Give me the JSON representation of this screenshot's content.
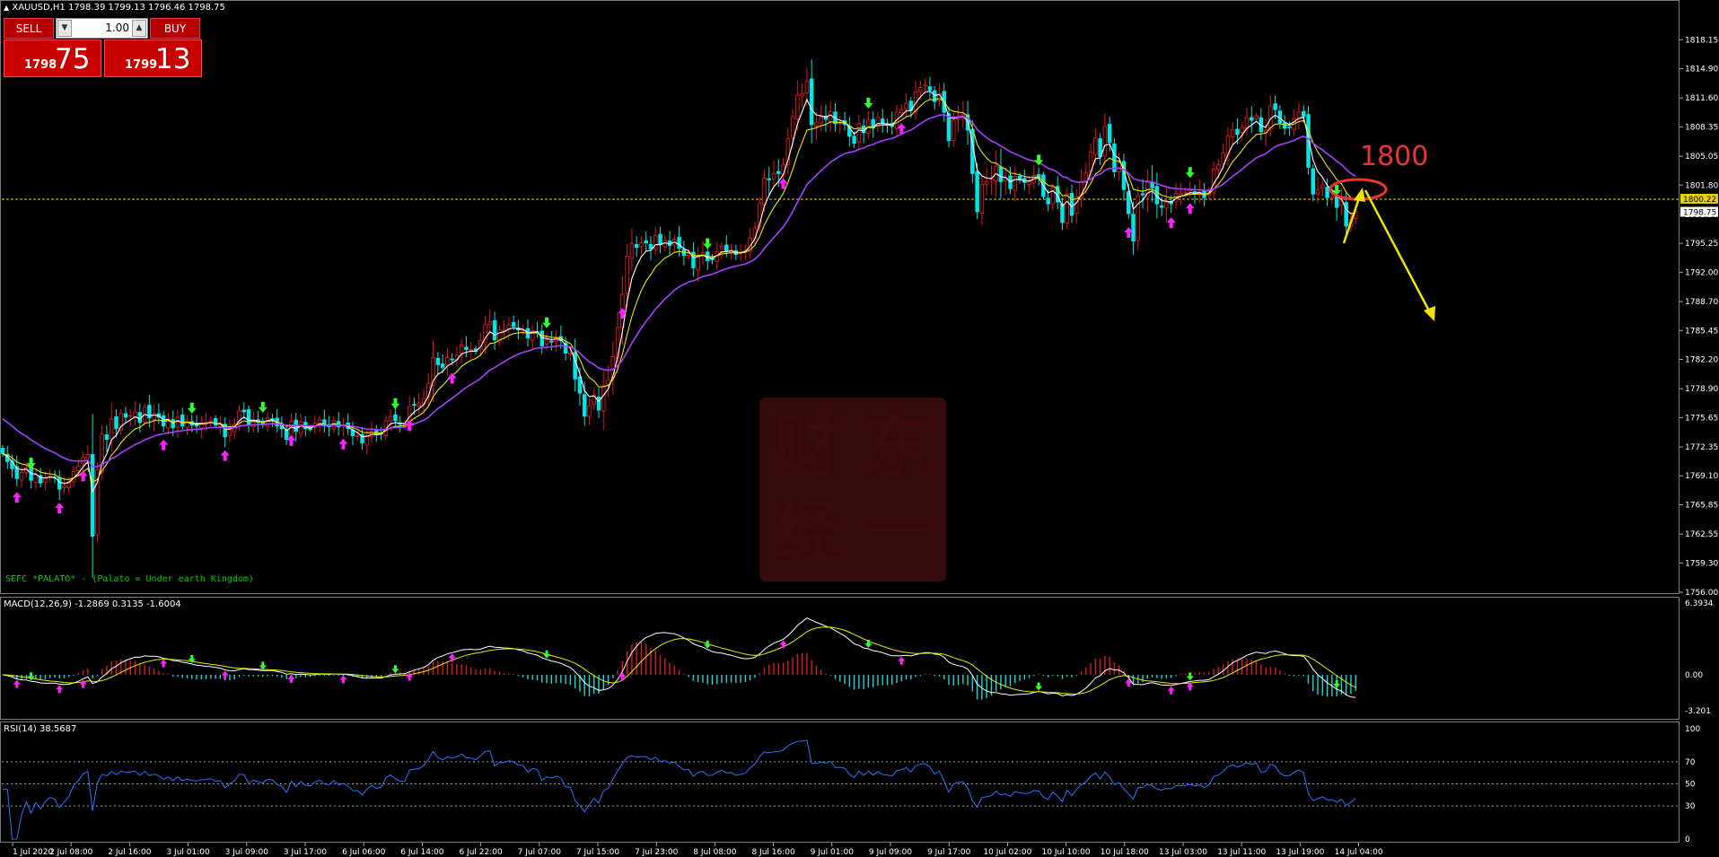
{
  "window": {
    "title": "XAUUSD,H1  1798.39 1799.13 1796.46 1798.75"
  },
  "trade_panel": {
    "sell_label": "SELL",
    "buy_label": "BUY",
    "lot_value": "1.00",
    "bid_small": "1798",
    "bid_big": "75",
    "ask_small": "1799",
    "ask_big": "13"
  },
  "colors": {
    "bull_candle": "#e01818",
    "bear_candle": "#00e6e6",
    "ma_fast": "#ffffff",
    "ma_mid": "#e8e800",
    "ma_slow": "#a640ff",
    "buy_arrow": "#ff20ff",
    "sell_arrow": "#30ff30",
    "rsi_line": "#2a73ff",
    "grid_dots": "#9a9a9a",
    "annotation": "#ee3333",
    "level_line": "#e6d200"
  },
  "indicator_caption": "SEFC *PALATO* - (Palato = Under earth Kingdom)",
  "macd_caption": "MACD(12,26,9) -1.2869 0.3135 -1.6004",
  "rsi_caption": "RSI(14) 38.5687",
  "watermark_chars": [
    "财",
    "东",
    "经",
    "一"
  ],
  "annotation_text": "1800",
  "chart_data": [
    {
      "type": "candlestick",
      "symbol": "XAUUSD",
      "timeframe": "H1",
      "ylim": [
        1756.0,
        1820.0
      ],
      "y_ticks": [
        "1818.15",
        "1814.90",
        "1811.60",
        "1808.35",
        "1805.05",
        "1801.80",
        "1798.50",
        "1795.25",
        "1792.00",
        "1788.70",
        "1785.45",
        "1782.20",
        "1778.90",
        "1775.65",
        "1772.35",
        "1769.10",
        "1765.85",
        "1762.55",
        "1759.30",
        "1756.00"
      ],
      "x_ticks": [
        "1 Jul 2020",
        "2 Jul 08:00",
        "2 Jul 16:00",
        "3 Jul 01:00",
        "3 Jul 09:00",
        "3 Jul 17:00",
        "6 Jul 06:00",
        "6 Jul 14:00",
        "6 Jul 22:00",
        "7 Jul 07:00",
        "7 Jul 15:00",
        "7 Jul 23:00",
        "8 Jul 08:00",
        "8 Jul 16:00",
        "9 Jul 01:00",
        "9 Jul 09:00",
        "9 Jul 17:00",
        "10 Jul 02:00",
        "10 Jul 10:00",
        "10 Jul 18:00",
        "13 Jul 03:00",
        "13 Jul 11:00",
        "13 Jul 19:00",
        "14 Jul 04:00"
      ],
      "price_labels": {
        "level": "1800.22",
        "bid": "1798.75"
      },
      "level_value": 1800.22,
      "bid_value": 1798.75,
      "closes": [
        1771.6,
        1770.7,
        1769.9,
        1768.8,
        1769.5,
        1770.0,
        1768.6,
        1769.2,
        1768.3,
        1768.8,
        1769.1,
        1768.9,
        1767.6,
        1768.0,
        1768.5,
        1769.6,
        1770.2,
        1771.2,
        1771.5,
        1762.3,
        1769.8,
        1773.8,
        1773.2,
        1775.5,
        1774.4,
        1776.1,
        1775.7,
        1775.9,
        1776.3,
        1775.1,
        1776.8,
        1775.6,
        1776.1,
        1775.7,
        1774.7,
        1775.5,
        1774.5,
        1775.7,
        1774.7,
        1775.2,
        1774.8,
        1774.7,
        1775.0,
        1775.1,
        1775.3,
        1774.8,
        1774.9,
        1773.5,
        1774.3,
        1774.9,
        1776.4,
        1776.3,
        1774.8,
        1775.4,
        1775.1,
        1774.9,
        1775.6,
        1775.5,
        1774.7,
        1774.4,
        1773.2,
        1775.2,
        1774.1,
        1775.2,
        1774.4,
        1774.3,
        1775.0,
        1775.4,
        1774.7,
        1774.6,
        1775.3,
        1774.6,
        1774.8,
        1774.4,
        1773.6,
        1773.6,
        1772.8,
        1773.6,
        1774.1,
        1773.7,
        1773.8,
        1775.3,
        1775.8,
        1775.3,
        1774.9,
        1774.9,
        1776.9,
        1777.1,
        1777.2,
        1777.8,
        1779.5,
        1782.4,
        1781.6,
        1781.3,
        1782.4,
        1782.2,
        1782.7,
        1783.8,
        1783.3,
        1783.3,
        1783.1,
        1784.3,
        1786.1,
        1786.4,
        1784.4,
        1785.5,
        1785.5,
        1786.1,
        1785.9,
        1785.5,
        1785.5,
        1784.6,
        1785.4,
        1785.3,
        1783.7,
        1784.4,
        1784.2,
        1784.6,
        1784.3,
        1782.9,
        1782.9,
        1780.0,
        1778.4,
        1775.8,
        1777.0,
        1778.2,
        1776.5,
        1779.2,
        1779.9,
        1782.5,
        1785.8,
        1789.5,
        1793.8,
        1795.2,
        1794.8,
        1795.3,
        1795.3,
        1794.6,
        1796.1,
        1795.1,
        1795.6,
        1795.0,
        1795.7,
        1794.7,
        1793.9,
        1794.1,
        1792.5,
        1793.9,
        1794.2,
        1793.3,
        1793.4,
        1794.3,
        1794.9,
        1794.4,
        1794.5,
        1794.0,
        1794.2,
        1794.5,
        1795.8,
        1797.0,
        1799.8,
        1802.6,
        1802.4,
        1803.1,
        1803.1,
        1804.1,
        1807.0,
        1809.5,
        1811.9,
        1812.1,
        1813.5,
        1808.6,
        1808.8,
        1809.4,
        1809.2,
        1810.1,
        1808.7,
        1808.8,
        1808.6,
        1807.3,
        1806.5,
        1808.7,
        1807.7,
        1809.1,
        1808.2,
        1809.4,
        1808.7,
        1808.6,
        1808.4,
        1810.0,
        1810.3,
        1811.0,
        1810.2,
        1812.3,
        1812.8,
        1813.1,
        1812.5,
        1811.2,
        1812.1,
        1810.0,
        1806.8,
        1809.1,
        1809.6,
        1809.8,
        1808.0,
        1803.1,
        1798.8,
        1801.9,
        1802.2,
        1802.5,
        1803.9,
        1802.2,
        1802.6,
        1801.4,
        1802.8,
        1802.4,
        1802.1,
        1802.2,
        1802.9,
        1802.7,
        1800.5,
        1799.7,
        1801.5,
        1799.9,
        1797.6,
        1800.8,
        1798.4,
        1800.5,
        1802.1,
        1803.2,
        1805.5,
        1807.1,
        1805.0,
        1808.4,
        1806.6,
        1803.3,
        1804.3,
        1801.3,
        1798.6,
        1795.5,
        1800.6,
        1800.7,
        1802.1,
        1801.5,
        1799.7,
        1799.3,
        1799.9,
        1799.7,
        1800.9,
        1800.9,
        1801.0,
        1801.3,
        1800.8,
        1801.1,
        1800.4,
        1801.1,
        1803.6,
        1804.1,
        1805.4,
        1807.3,
        1808.0,
        1807.5,
        1808.3,
        1809.4,
        1809.1,
        1809.6,
        1807.8,
        1808.0,
        1810.7,
        1810.3,
        1808.8,
        1808.2,
        1808.3,
        1809.3,
        1810.0,
        1809.5,
        1803.8,
        1800.8,
        1801.3,
        1801.8,
        1800.4,
        1800.5,
        1799.3,
        1800.0,
        1797.2,
        1797.9,
        1798.8
      ],
      "volatility": [
        0.8,
        1.3,
        1.3,
        1.7,
        1.1,
        1.3,
        1.5,
        0.8,
        0.8,
        1.2,
        1.6,
        0.9,
        1.7,
        1.1,
        0.6,
        1.4,
        1.0,
        1.1,
        1.3,
        9.6,
        1.8,
        1.5,
        2.1,
        2.9,
        1.4,
        1.1,
        0.9,
        1.4,
        1.6,
        1.7,
        1.0,
        1.8,
        1.9,
        1.4,
        0.7,
        1.5,
        1.5,
        1.6,
        0.7,
        1.1,
        1.8,
        1.3,
        1.5,
        1.6,
        0.6,
        0.8,
        1.3,
        1.5,
        1.5,
        1.0,
        1.4,
        1.2,
        0.8,
        1.2,
        1.7,
        0.9,
        0.8,
        1.0,
        1.3,
        1.4,
        1.4,
        1.2,
        1.6,
        0.9,
        1.0,
        0.6,
        1.1,
        0.8,
        1.4,
        1.6,
        1.1,
        1.6,
        1.6,
        1.3,
        1.6,
        1.3,
        1.1,
        1.4,
        1.4,
        0.9,
        1.5,
        0.6,
        1.4,
        1.2,
        1.2,
        1.0,
        1.8,
        1.4,
        1.6,
        1.8,
        2.5,
        3.6,
        1.3,
        1.3,
        1.8,
        1.4,
        1.4,
        1.3,
        1.7,
        1.4,
        0.8,
        1.3,
        1.9,
        2.1,
        1.7,
        1.0,
        1.7,
        1.6,
        0.7,
        1.5,
        1.2,
        1.6,
        1.2,
        1.3,
        1.2,
        1.7,
        1.7,
        1.6,
        1.7,
        1.0,
        1.8,
        2.6,
        2.1,
        2.1,
        1.3,
        1.5,
        1.5,
        3.6,
        2.6,
        3.4,
        3.8,
        3.8,
        2.7,
        2.7,
        1.6,
        1.8,
        1.5,
        1.8,
        1.1,
        1.3,
        1.0,
        1.7,
        1.0,
        1.8,
        1.7,
        1.1,
        1.7,
        1.9,
        2.0,
        1.5,
        1.1,
        1.7,
        0.8,
        1.3,
        0.9,
        1.4,
        1.3,
        1.3,
        1.6,
        1.0,
        1.4,
        1.2,
        2.7,
        2.2,
        2.5,
        1.7,
        1.9,
        1.7,
        2.7,
        2.0,
        3.3,
        4.1,
        2.5,
        2.0,
        2.3,
        2.5,
        1.4,
        1.6,
        1.2,
        1.8,
        1.2,
        1.4,
        1.6,
        1.1,
        1.5,
        1.5,
        1.7,
        1.0,
        1.8,
        1.3,
        1.3,
        1.7,
        0.8,
        1.7,
        1.1,
        1.6,
        1.7,
        0.9,
        1.2,
        1.6,
        1.7,
        1.0,
        2.2,
        2.1,
        2.9,
        2.3,
        1.3,
        1.9,
        2.5,
        2.9,
        4.0,
        3.8,
        2.4,
        1.1,
        1.9,
        0.9,
        1.4,
        1.2,
        1.5,
        1.3,
        0.8,
        1.3,
        0.7,
        1.5,
        1.1,
        1.4,
        1.4,
        1.6,
        2.1,
        2.0,
        2.1,
        1.7,
        1.1,
        2.1,
        1.4,
        1.4,
        1.7,
        1.7,
        1.0,
        2.6,
        2.4,
        2.9,
        3.0,
        3.3,
        2.9,
        2.2,
        2.9,
        1.2,
        1.5,
        1.9,
        1.0,
        1.2,
        1.5,
        1.9,
        1.4,
        1.0,
        1.0,
        1.2,
        1.3,
        1.8,
        2.0,
        1.9,
        1.0,
        1.5,
        2.3,
        0.8,
        1.6,
        2.5,
        1.6,
        1.6,
        1.5,
        1.1,
        1.1,
        1.3,
        1.8,
        1.5,
        1.3,
        0.8,
        2.0,
        1.3,
        2.2,
        1.1,
        2.3,
        2.2,
        2.1,
        1.5,
        1.0,
        1.9,
        1.7,
        1.4,
        1.4,
        2.1,
        1.4,
        1.3,
        1.8
      ],
      "buy_signals": [
        3,
        12,
        17,
        34,
        47,
        61,
        72,
        86,
        95,
        131,
        165,
        190,
        238,
        251,
        247
      ],
      "sell_signals": [
        6,
        40,
        55,
        83,
        115,
        149,
        183,
        219,
        251,
        282
      ]
    },
    {
      "type": "macd",
      "params": "12,26,9",
      "ylim": [
        -3.201,
        6.3934
      ],
      "y_ticks": [
        "6.3934",
        "0.00",
        "-3.201"
      ]
    },
    {
      "type": "rsi",
      "period": 14,
      "ylim": [
        0,
        100
      ],
      "y_ticks": [
        "100",
        "70",
        "50",
        "30",
        "0"
      ],
      "levels": [
        70,
        50,
        30
      ]
    }
  ]
}
